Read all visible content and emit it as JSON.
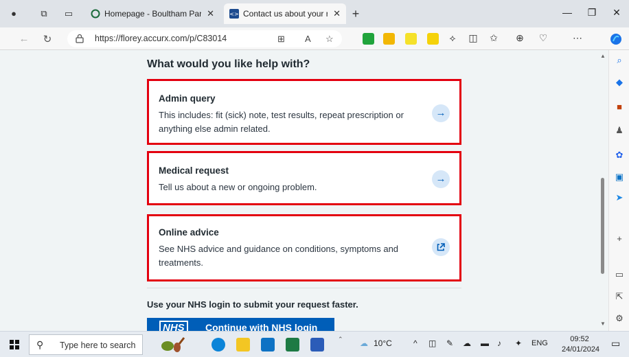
{
  "browser": {
    "tabs": [
      {
        "title": "Homepage - Boultham Park Med",
        "active": false
      },
      {
        "title": "Contact us about your request",
        "active": true
      }
    ],
    "new_tab": "+",
    "url": "https://florey.accurx.com/p/C83014",
    "window_controls": {
      "minimize": "—",
      "restore": "❐",
      "close": "✕"
    }
  },
  "page": {
    "heading": "What would you like help with?",
    "cards": [
      {
        "title": "Admin query",
        "description": "This includes: fit (sick) note, test results, repeat prescription or anything else admin related.",
        "icon": "arrow-right-icon"
      },
      {
        "title": "Medical request",
        "description": "Tell us about a new or ongoing problem.",
        "icon": "arrow-right-icon"
      },
      {
        "title": "Online advice",
        "description": "See NHS advice and guidance on conditions, symptoms and treatments.",
        "icon": "external-link-icon"
      }
    ],
    "nhs_prompt": "Use your NHS login to submit your request faster.",
    "nhs_logo": "NHS",
    "nhs_button": "Continue with NHS login"
  },
  "taskbar": {
    "search_placeholder": "Type here to search",
    "weather": "10°C",
    "language": "ENG",
    "time": "09:52",
    "date": "24/01/2024"
  },
  "colors": {
    "highlight_border": "#e3000f",
    "nhs_blue": "#005eb8",
    "page_bg": "#f0f4f5"
  }
}
